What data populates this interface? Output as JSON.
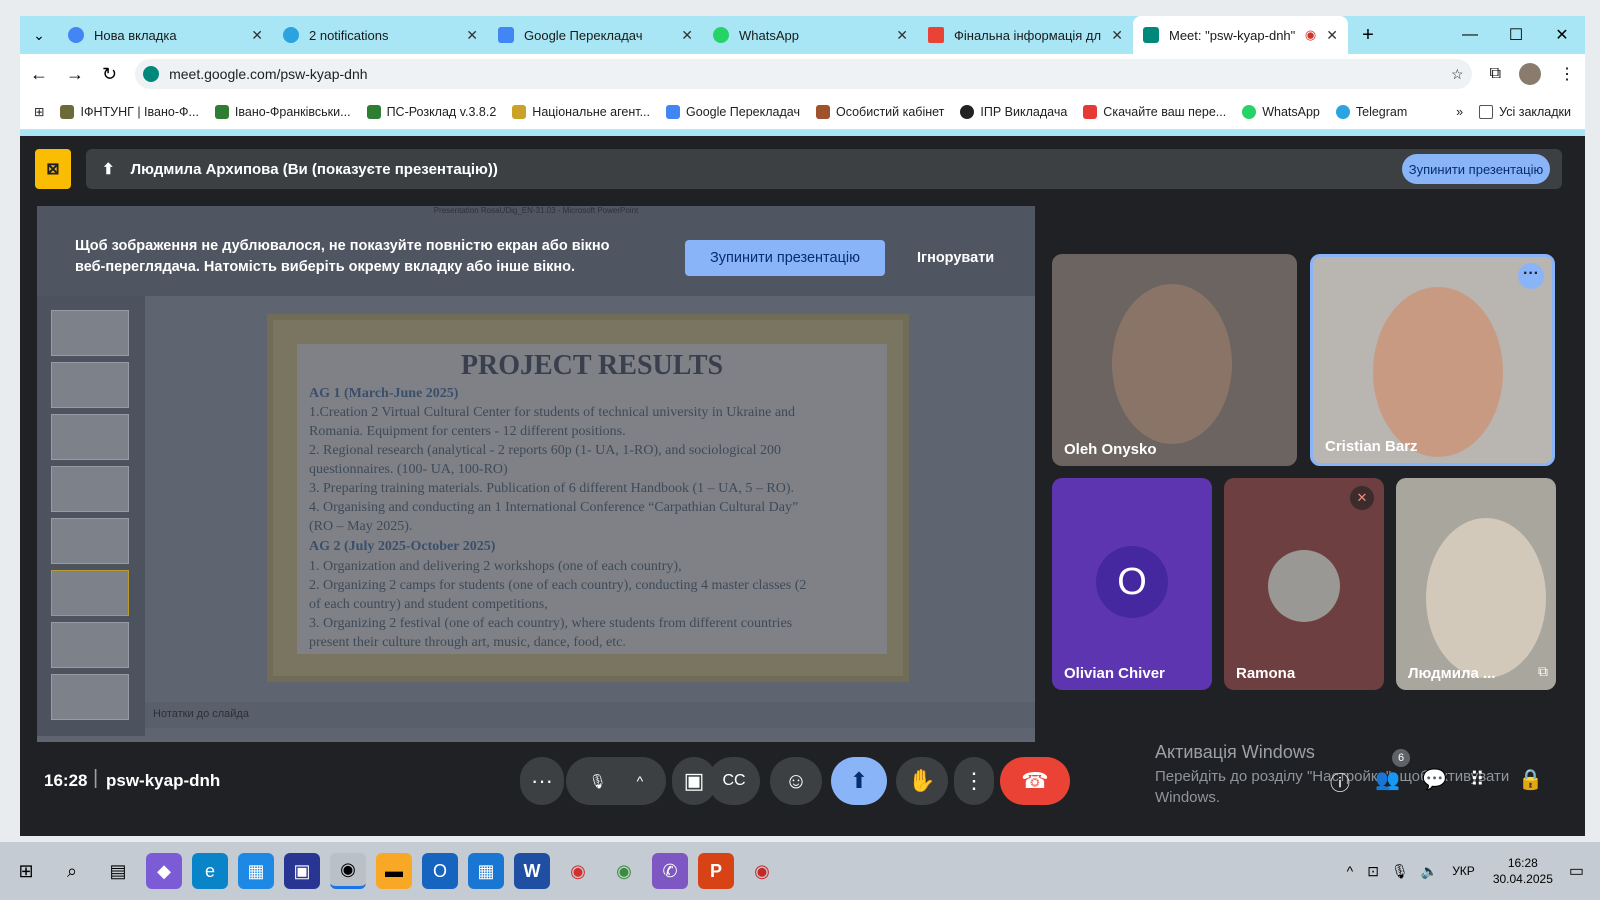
{
  "browser": {
    "tabs": [
      {
        "title": "Нова вкладка",
        "icon": "chrome-icon",
        "color": "#4285f4"
      },
      {
        "title": "2 notifications",
        "icon": "telegram-icon",
        "color": "#2aa3e0"
      },
      {
        "title": "Google Перекладач",
        "icon": "translate-icon",
        "color": "#4285f4"
      },
      {
        "title": "WhatsApp",
        "icon": "whatsapp-icon",
        "color": "#25d366"
      },
      {
        "title": "Фінальна інформація для с",
        "icon": "gmail-icon",
        "color": "#ea4335"
      },
      {
        "title": "Meet: \"psw-kyap-dnh\"",
        "icon": "meet-icon",
        "color": "#00897b"
      }
    ],
    "url": "meet.google.com/psw-kyap-dnh",
    "bookmarks": [
      "ІФНТУНГ | Івано-Ф...",
      "Івано-Франківськи...",
      "ПС-Розклад v.3.8.2",
      "Національне агент...",
      "Google Перекладач",
      "Особистий кабінет",
      "ІПР Викладача",
      "Скачайте ваш пере...",
      "WhatsApp",
      "Telegram"
    ],
    "all_bookmarks": "Усі закладки"
  },
  "meet": {
    "presenting_text": "Людмила Архипова (Ви (показуєте презентацію))",
    "stop_top": "Зупинити презентацію",
    "warning": "Щоб зображення не дублювалося, не показуйте повністю екран або вікно веб-переглядача. Натомість виберіть окрему вкладку або інше вікно.",
    "stop_presenting": "Зупинити презентацію",
    "ignore": "Ігнорувати",
    "ppt_title": "Presentation RosaUDig_EN-31.03 - Microsoft PowerPoint",
    "notes_label": "Нотатки до слайда",
    "slide": {
      "title": "PROJECT RESULTS",
      "lines": [
        "AG 1 (March-June 2025)",
        "1.Creation 2 Virtual Cultural Center for students of technical university in Ukraine and",
        "Romania. Equipment for centers - 12 different positions.",
        "2. Regional research (analytical - 2 reports 60p (1- UA, 1-RO),  and sociological 200",
        "questionnaires. (100- UA, 100-RO)",
        "3. Preparing training materials. Publication of 6 different Handbook (1 – UA, 5 – RO).",
        "4. Organising and conducting an 1 International Conference “Carpathian Cultural Day”",
        "(RO – May 2025).",
        "AG 2 (July 2025-October 2025)",
        "1.    Organization and delivering 2 workshops  (one of  each country),",
        "2.    Organizing 2 camps for students (one of each country), conducting 4 master classes (2",
        "       of each country) and student competitions,",
        "3.    Organizing 2 festival (one of each country), where students from different countries",
        "       present their culture through art, music, dance, food, etc."
      ]
    },
    "participants": [
      {
        "name": "Oleh Onysko"
      },
      {
        "name": "Cristian Barz"
      },
      {
        "name": "Olivian Chiver",
        "initial": "O"
      },
      {
        "name": "Ramona"
      },
      {
        "name": "Людмила ..."
      }
    ],
    "time": "16:28",
    "meeting_code": "psw-kyap-dnh",
    "people_count": "6",
    "activation_title": "Активація Windows",
    "activation_text": "Перейдіть до розділу \"Настройки\", щоб активувати Windows."
  },
  "taskbar": {
    "lang": "УКР",
    "time": "16:28",
    "date": "30.04.2025"
  }
}
